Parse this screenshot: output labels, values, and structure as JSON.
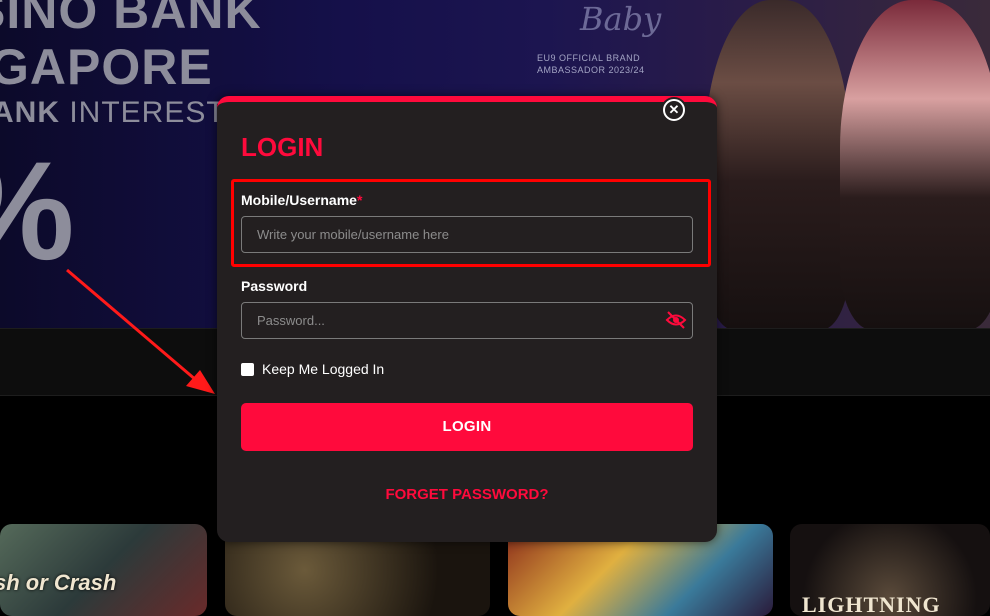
{
  "background": {
    "hero_lines": [
      "SINO BANK",
      "GAPORE",
      "ANK",
      "INTEREST",
      "%"
    ],
    "ambassador_signature": "Baby",
    "ambassador_caption": [
      "EU9 OFFICIAL BRAND",
      "AMBASSADOR 2023/24"
    ],
    "game_cards": [
      "sh or Crash",
      "LIGHTNING"
    ]
  },
  "modal": {
    "title": "LOGIN",
    "username": {
      "label": "Mobile/Username",
      "required_mark": "*",
      "placeholder": "Write your mobile/username here"
    },
    "password": {
      "label": "Password",
      "placeholder": "Password..."
    },
    "remember_label": "Keep Me Logged In",
    "login_button": "LOGIN",
    "forget_link": "FORGET PASSWORD?"
  },
  "colors": {
    "accent": "#ff0a3c",
    "modal_bg": "#231f20",
    "highlight_box": "#ff0000"
  },
  "icons": {
    "close": "close-icon",
    "password_visibility": "eye-slash-icon"
  }
}
